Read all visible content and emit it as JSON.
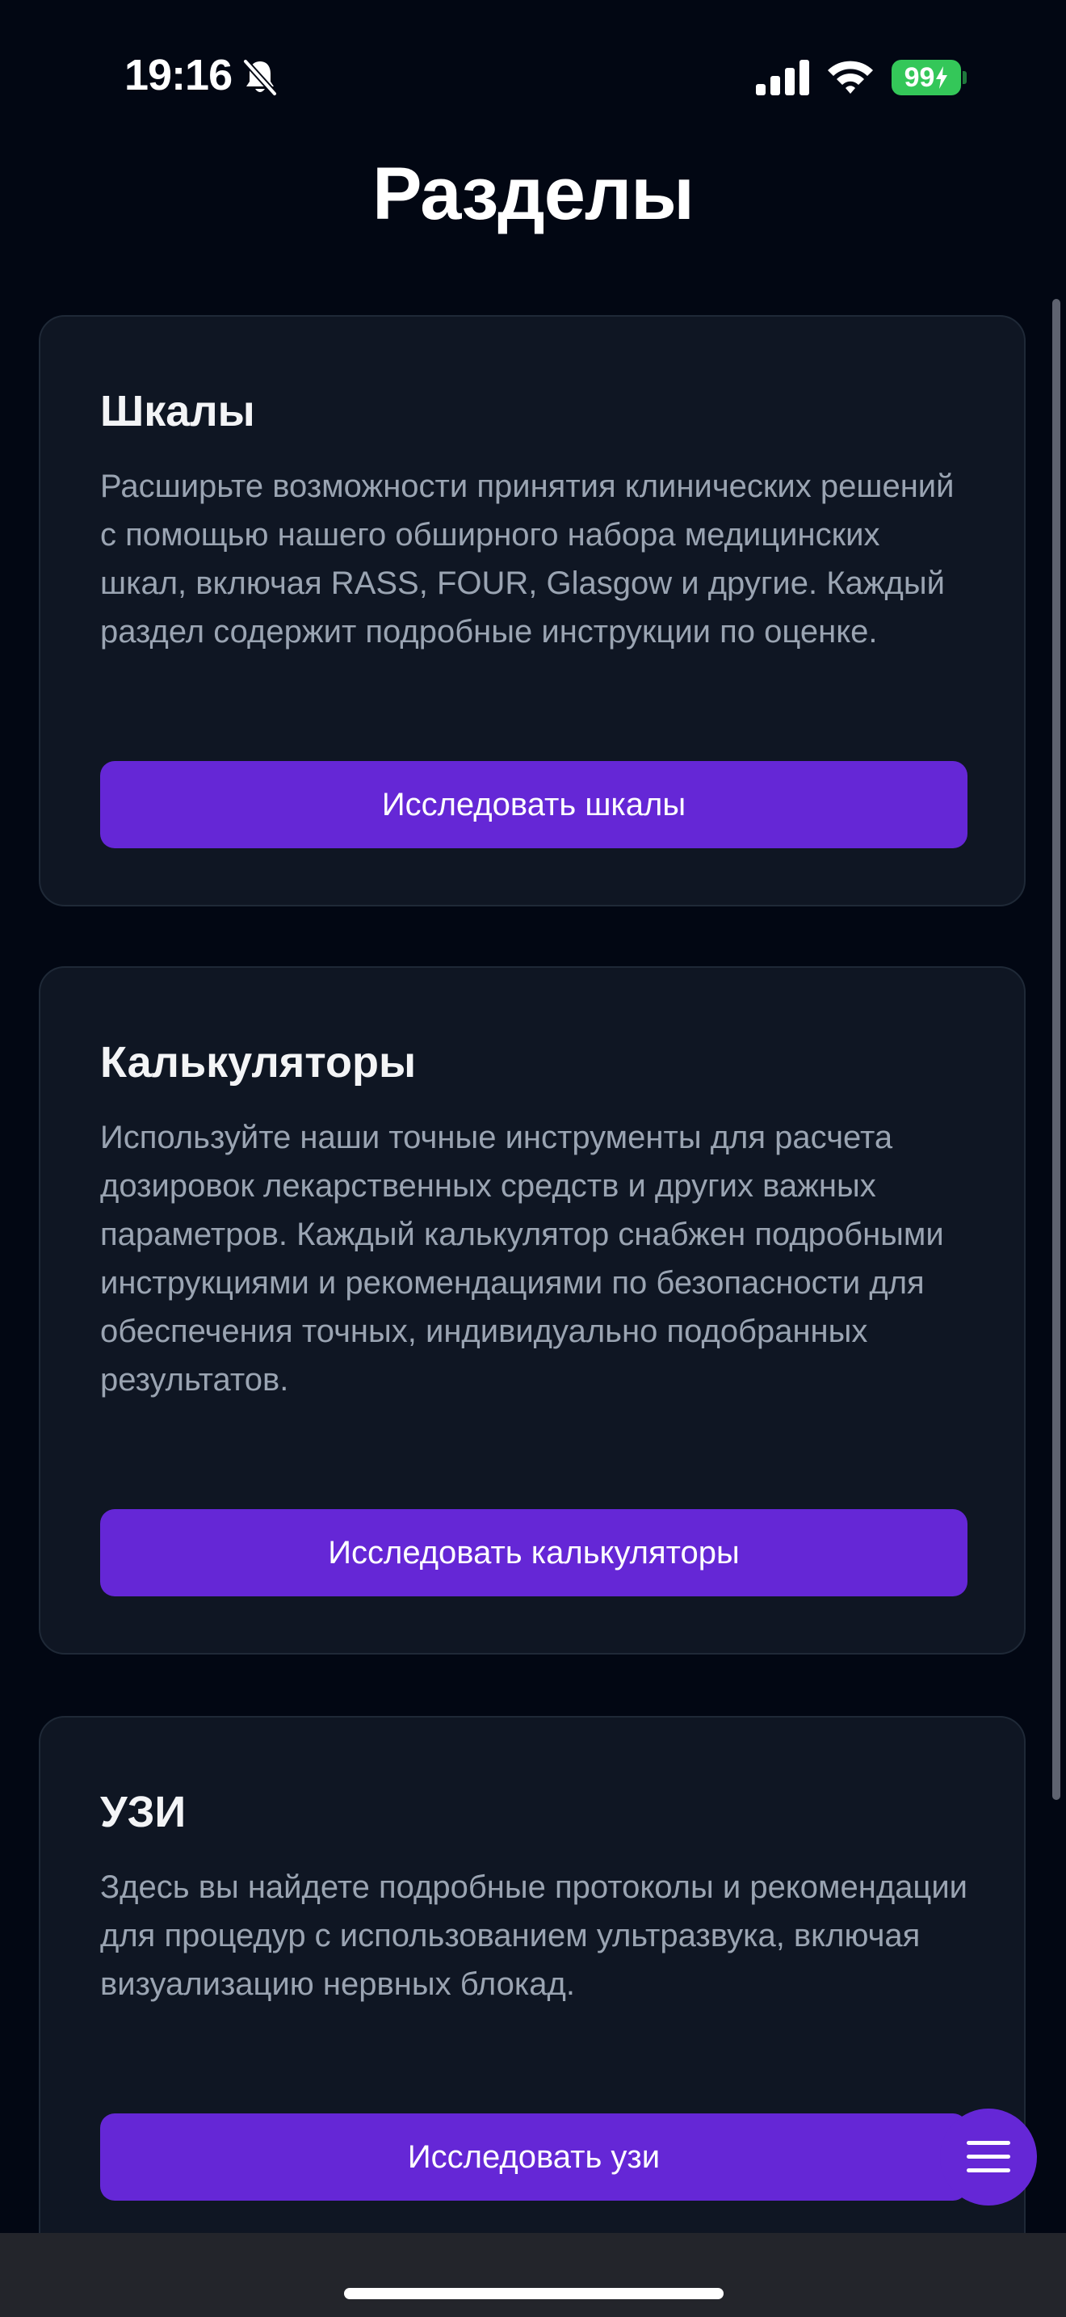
{
  "status_bar": {
    "time": "19:16",
    "battery": "99",
    "icons": [
      "bell-slash-icon",
      "signal-icon",
      "wifi-icon",
      "battery-icon",
      "bolt-icon"
    ]
  },
  "page": {
    "title": "Разделы"
  },
  "cards": [
    {
      "title": "Шкалы",
      "description": "Расширьте возможности принятия клинических решений с помощью нашего обширного набора медицинских шкал, включая RASS, FOUR, Glasgow и другие. Каждый раздел содержит подробные инструкции по оценке.",
      "button": "Исследовать шкалы"
    },
    {
      "title": "Калькуляторы",
      "description": "Используйте наши точные инструменты для расчета дозировок лекарственных средств и других важных параметров. Каждый калькулятор снабжен подробными инструкциями и рекомендациями по безопасности для обеспечения точных, индивидуально подобранных результатов.",
      "button": "Исследовать калькуляторы"
    },
    {
      "title": "УЗИ",
      "description": "Здесь вы найдете подробные протоколы и рекомендации для процедур с использованием ультразвука, включая визуализацию нервных блокад.",
      "button": "Исследовать узи"
    }
  ],
  "fab": {
    "icon": "menu-icon"
  },
  "colors": {
    "background": "#020713",
    "card": "#0f1623",
    "accent": "#6527d6",
    "text_muted": "#9aa4b2",
    "battery": "#34c759"
  }
}
